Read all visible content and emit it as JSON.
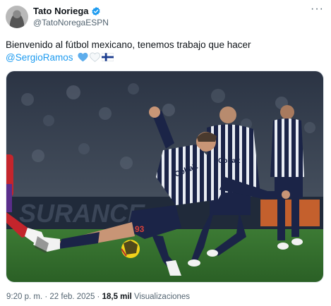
{
  "author": {
    "display_name": "Tato Noriega",
    "handle": "@TatoNoregaESPN"
  },
  "tweet": {
    "text": "Bienvenido al fútbol mexicano, tenemos trabajo que hacer",
    "mention": "@SergioRamos",
    "emoji_icons": [
      "blue-heart-icon",
      "white-heart-icon",
      "finland-flag-icon"
    ]
  },
  "media": {
    "ad_board_text": "SURANCE",
    "player_front_number": "93",
    "sponsor_text": "Cobalt"
  },
  "footer": {
    "time": "9:20 p. m.",
    "separator": "·",
    "date": "22 feb. 2025",
    "views_count": "18,5 mil",
    "views_label": "Visualizaciones"
  },
  "colors": {
    "link": "#1d9bf0",
    "secondary_text": "#536471",
    "kit_navy": "#1b2447",
    "pitch_green": "#2f6b2a"
  }
}
